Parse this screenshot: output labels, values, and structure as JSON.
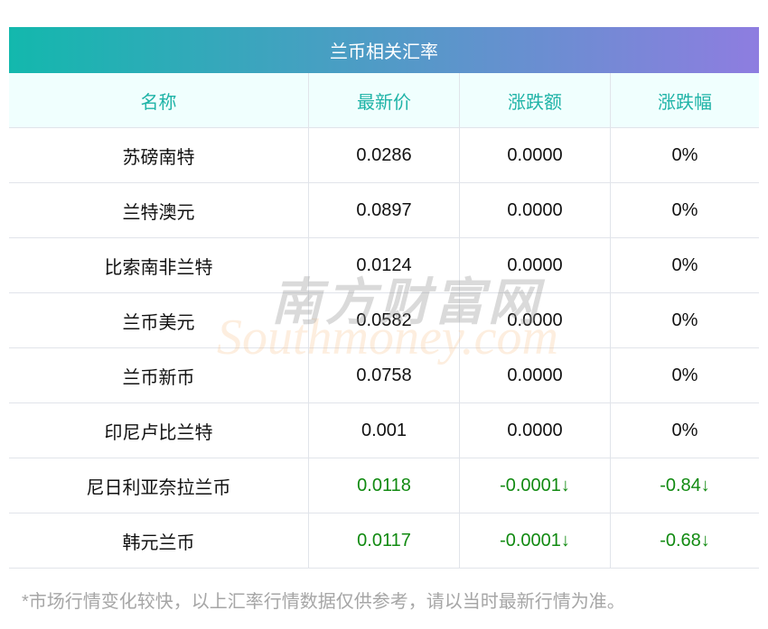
{
  "title": "兰币相关汇率",
  "columns": [
    "名称",
    "最新价",
    "涨跌额",
    "涨跌幅"
  ],
  "rows": [
    {
      "name": "苏磅南特",
      "price": "0.0286",
      "change": "0.0000",
      "pct": "0%",
      "trend": "flat"
    },
    {
      "name": "兰特澳元",
      "price": "0.0897",
      "change": "0.0000",
      "pct": "0%",
      "trend": "flat"
    },
    {
      "name": "比索南非兰特",
      "price": "0.0124",
      "change": "0.0000",
      "pct": "0%",
      "trend": "flat"
    },
    {
      "name": "兰币美元",
      "price": "0.0582",
      "change": "0.0000",
      "pct": "0%",
      "trend": "flat"
    },
    {
      "name": "兰币新币",
      "price": "0.0758",
      "change": "0.0000",
      "pct": "0%",
      "trend": "flat"
    },
    {
      "name": "印尼卢比兰特",
      "price": "0.001",
      "change": "0.0000",
      "pct": "0%",
      "trend": "flat"
    },
    {
      "name": "尼日利亚奈拉兰币",
      "price": "0.0118",
      "change": "-0.0001↓",
      "pct": "-0.84↓",
      "trend": "down"
    },
    {
      "name": "韩元兰币",
      "price": "0.0117",
      "change": "-0.0001↓",
      "pct": "-0.68↓",
      "trend": "down"
    }
  ],
  "footer": "*市场行情变化较快，以上汇率行情数据仅供参考，请以当时最新行情为准。",
  "watermark": {
    "cn": "南方财富网",
    "en": "Southmoney.com"
  },
  "colors": {
    "header_text": "#1fb3a7",
    "down": "#118a11",
    "gradient_start": "#13b8ad",
    "gradient_end": "#8e7de0"
  }
}
